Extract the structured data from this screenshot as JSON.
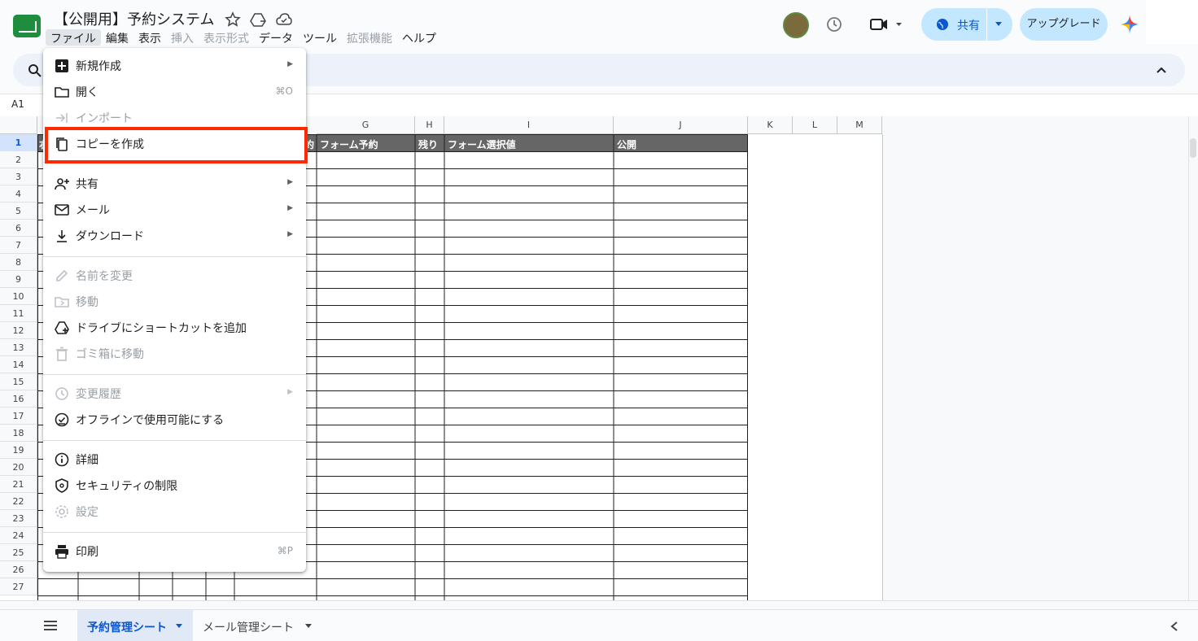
{
  "app": {
    "title": "【公開用】予約システム",
    "menu": [
      "ファイル",
      "編集",
      "表示",
      "挿入",
      "表示形式",
      "データ",
      "ツール",
      "拡張機能",
      "ヘルプ"
    ],
    "menu_disabled": [
      3,
      4,
      7
    ],
    "share_label": "共有",
    "upgrade_label": "アップグレード",
    "cell_ref": "A1"
  },
  "grid": {
    "columns": [
      "G",
      "H",
      "I",
      "J",
      "K",
      "L",
      "M"
    ],
    "rows": [
      "1",
      "2",
      "3",
      "4",
      "5",
      "6",
      "7",
      "8",
      "9",
      "10",
      "11",
      "12",
      "13",
      "14",
      "15",
      "16",
      "17",
      "18",
      "19",
      "20",
      "21",
      "22",
      "23",
      "24",
      "25",
      "26",
      "27"
    ],
    "header_cells": [
      "約",
      "フォーム予約",
      "残り",
      "フォーム選択値",
      "公開"
    ],
    "left_partial_header": "右"
  },
  "file_menu": {
    "items": [
      {
        "label": "新規作成",
        "icon": "new-sheet-icon",
        "submenu": true,
        "disabled": false
      },
      {
        "label": "開く",
        "icon": "folder-icon",
        "shortcut": "⌘O",
        "disabled": false
      },
      {
        "label": "インポート",
        "icon": "import-icon",
        "disabled": true
      },
      {
        "label": "コピーを作成",
        "icon": "copy-icon",
        "disabled": false
      },
      {
        "label": "共有",
        "icon": "person-add-icon",
        "submenu": true,
        "disabled": false
      },
      {
        "label": "メール",
        "icon": "mail-icon",
        "submenu": true,
        "disabled": false
      },
      {
        "label": "ダウンロード",
        "icon": "download-icon",
        "submenu": true,
        "disabled": false
      },
      {
        "label": "名前を変更",
        "icon": "pencil-icon",
        "disabled": true
      },
      {
        "label": "移動",
        "icon": "move-folder-icon",
        "disabled": true
      },
      {
        "label": "ドライブにショートカットを追加",
        "icon": "drive-shortcut-icon",
        "disabled": false
      },
      {
        "label": "ゴミ箱に移動",
        "icon": "trash-icon",
        "disabled": true
      },
      {
        "label": "変更履歴",
        "icon": "history-icon",
        "submenu": true,
        "disabled": true
      },
      {
        "label": "オフラインで使用可能にする",
        "icon": "offline-check-icon",
        "disabled": false
      },
      {
        "label": "詳細",
        "icon": "info-icon",
        "disabled": false
      },
      {
        "label": "セキュリティの制限",
        "icon": "shield-lock-icon",
        "disabled": false
      },
      {
        "label": "設定",
        "icon": "gear-icon",
        "disabled": true
      },
      {
        "label": "印刷",
        "icon": "printer-icon",
        "shortcut": "⌘P",
        "disabled": false
      }
    ]
  },
  "sheets": {
    "tabs": [
      "予約管理シート",
      "メール管理シート"
    ],
    "active": 0
  }
}
